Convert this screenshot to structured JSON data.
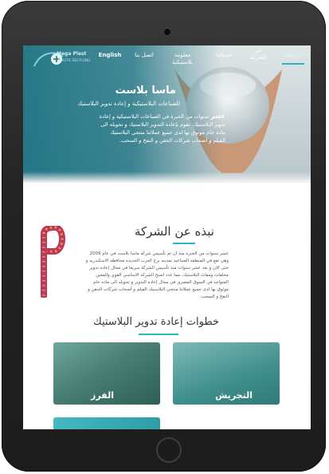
{
  "brand": {
    "logo_text": "Mega Plast",
    "logo_sub": "PLASTIC RECYCLING"
  },
  "nav": {
    "items": [
      {
        "label": "الرئيسية",
        "active": true
      },
      {
        "label": "عن الشركة"
      },
      {
        "label": "خدماتنا"
      },
      {
        "label": "معلومة بلاستيكية"
      },
      {
        "label": "اتصل بنا"
      },
      {
        "label": "English"
      }
    ]
  },
  "hero": {
    "title": "ماسا بلاست",
    "subtitle": "للصناعات البلاستيكية و إعادة تدوير البلاستيك",
    "body_bold": "عشر",
    "body": "سنوات من الخبرة في الصناعات البلاستيكية و إعادة تدوير البلاستيك، نقوم بإعاده التدوير البلاستيك و تحويله الى ماده خام موثوق بها لدى جميع عملائنا منتجي البلاستيك الفيلم و أصحاب شركات الحقن و النفخ و السحب."
  },
  "about": {
    "title": "نبذه عن الشركة",
    "text": "عشر سنوات من الخبره منذ ان تم تأسيس شركة ماسا بلاست في عام 2009 وهي تقع في المنطقه الصناعيه بمدينه برج العرب الجديده محافظه الاسكندريه و حتى الان و بعد عشر سنوات منذ تأسيس الشركة سريعا في مجال إعاده تدوير مخلفات ومفات البلاستيك، مما عدد اصبح الشركه الاساسي القوي والمعين المتواجد في السوق المصري في مجال إعاده التدوير و تحويله الى ماده خام موثوق بها لدى جميع عملائنا منتجي البلاستيك الفيلم و أصحاب شركات الحقن و النفخ و السحب."
  },
  "steps": {
    "title": "خطوات إعادة تدوير البلاستيك",
    "cards": [
      {
        "label": "التجريش"
      },
      {
        "label": "الفرز"
      }
    ]
  },
  "colors": {
    "accent": "#2bb6c1",
    "overlay": "#177080"
  }
}
